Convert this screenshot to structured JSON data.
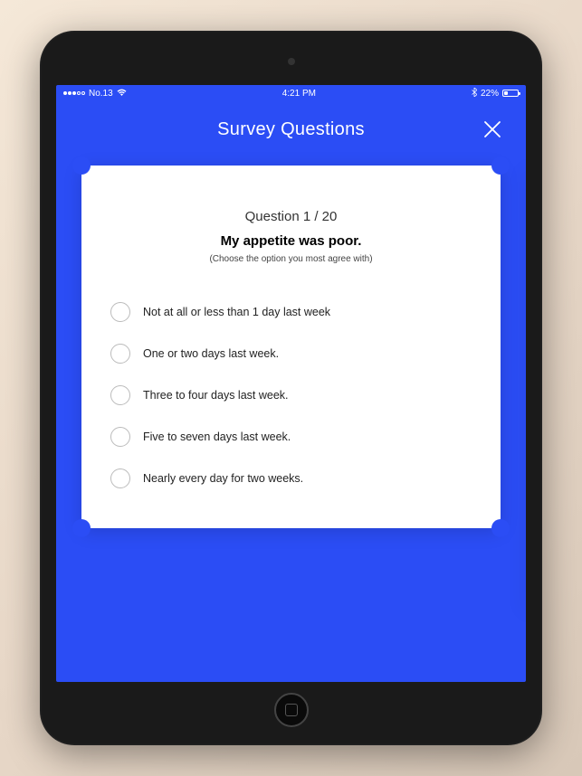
{
  "status_bar": {
    "carrier": "No.13",
    "time": "4:21 PM",
    "battery_percent": "22%"
  },
  "header": {
    "title": "Survey Questions"
  },
  "question": {
    "counter": "Question 1 / 20",
    "text": "My appetite was poor.",
    "hint": "(Choose the option you most agree with)"
  },
  "options": [
    {
      "label": "Not at all or less than 1 day last week"
    },
    {
      "label": "One or two days last week."
    },
    {
      "label": "Three to four days last week."
    },
    {
      "label": "Five to seven days last week."
    },
    {
      "label": "Nearly every day for two weeks."
    }
  ]
}
